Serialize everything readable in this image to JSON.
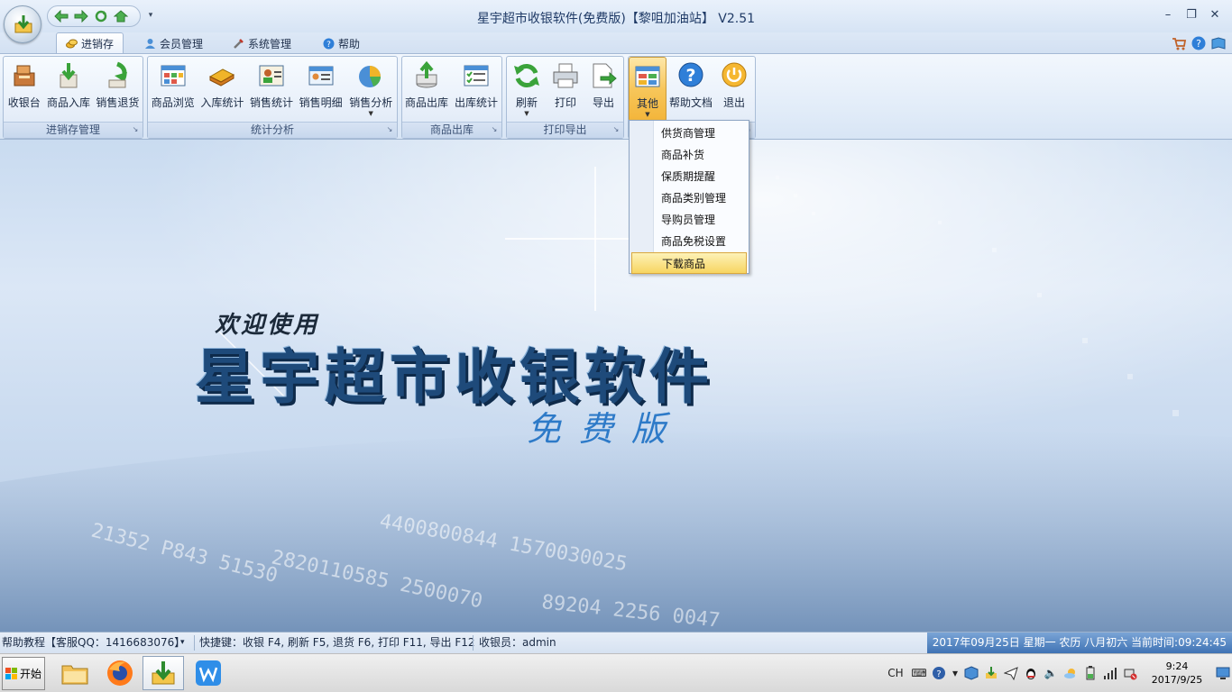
{
  "window": {
    "title": "星宇超市收银软件(免费版)【黎咀加油站】 V2.51",
    "controls": {
      "minimize": "–",
      "restore": "❐",
      "close": "✕"
    }
  },
  "tabs": [
    {
      "label": "进销存",
      "active": true
    },
    {
      "label": "会员管理",
      "active": false
    },
    {
      "label": "系统管理",
      "active": false
    },
    {
      "label": "帮助",
      "active": false
    }
  ],
  "ribbon": {
    "groups": [
      {
        "caption": "进销存管理",
        "buttons": [
          "收银台",
          "商品入库",
          "销售退货"
        ]
      },
      {
        "caption": "统计分析",
        "buttons": [
          "商品浏览",
          "入库统计",
          "销售统计",
          "销售明细",
          "销售分析"
        ]
      },
      {
        "caption": "商品出库",
        "buttons": [
          "商品出库",
          "出库统计"
        ]
      },
      {
        "caption": "打印导出",
        "buttons": [
          "刷新",
          "打印",
          "导出"
        ]
      },
      {
        "caption": "",
        "buttons": [
          "其他",
          "帮助文档",
          "退出"
        ]
      }
    ]
  },
  "dropdown": {
    "items": [
      "供货商管理",
      "商品补货",
      "保质期提醒",
      "商品类别管理",
      "导购员管理",
      "商品免税设置",
      "下载商品"
    ],
    "highlighted_index": 6
  },
  "splash": {
    "welcome": "欢迎使用",
    "brand": "星宇超市收银软件",
    "edition": "免费版"
  },
  "statusbar": {
    "help": "帮助教程【客服QQ：1416683076】",
    "shortcuts": "快捷键：收银 F4, 刷新 F5, 退货 F6, 打印 F11, 导出 F12",
    "cashier": "收银员：admin",
    "datetime": "2017年09月25日 星期一 农历 八月初六 当前时间:09:24:45"
  },
  "taskbar": {
    "start": "开始",
    "lang": "CH",
    "clock_time": "9:24",
    "clock_date": "2017/9/25"
  },
  "colors": {
    "ribbon_accent": "#f7c65a",
    "statusbar_highlight": "#3f73b4",
    "brand_text": "#1e4a7a"
  }
}
